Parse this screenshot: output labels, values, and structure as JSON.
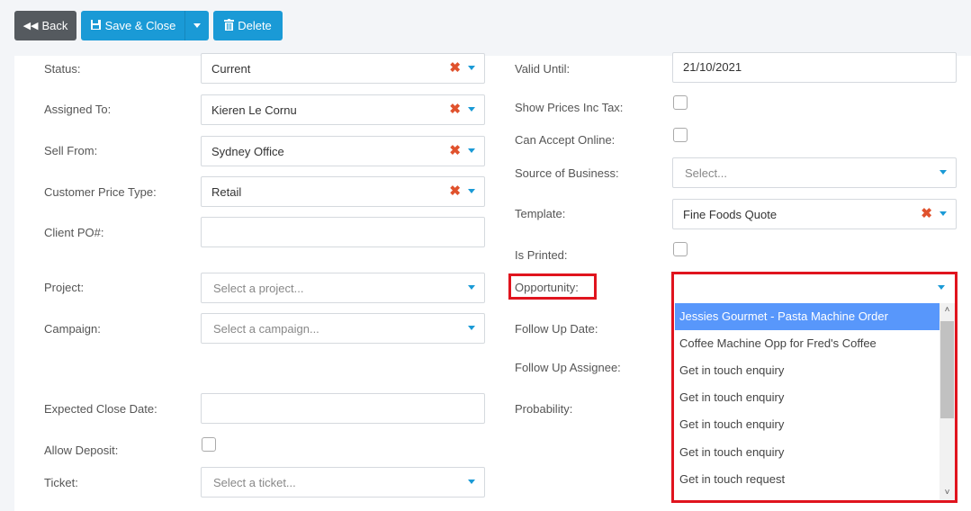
{
  "toolbar": {
    "back_label": "Back",
    "save_close_label": "Save & Close",
    "delete_label": "Delete"
  },
  "left": {
    "status": {
      "label": "Status:",
      "value": "Current"
    },
    "assigned_to": {
      "label": "Assigned To:",
      "value": "Kieren Le Cornu"
    },
    "sell_from": {
      "label": "Sell From:",
      "value": "Sydney Office"
    },
    "customer_price_type": {
      "label": "Customer Price Type:",
      "value": "Retail"
    },
    "client_po": {
      "label": "Client PO#:",
      "value": ""
    },
    "project": {
      "label": "Project:",
      "placeholder": "Select a project..."
    },
    "campaign": {
      "label": "Campaign:",
      "placeholder": "Select a campaign..."
    },
    "expected_close_date": {
      "label": "Expected Close Date:",
      "value": ""
    },
    "allow_deposit": {
      "label": "Allow Deposit:",
      "checked": false
    },
    "ticket": {
      "label": "Ticket:",
      "placeholder": "Select a ticket..."
    }
  },
  "right": {
    "valid_until": {
      "label": "Valid Until:",
      "value": "21/10/2021"
    },
    "show_prices_inc_tax": {
      "label": "Show Prices Inc Tax:",
      "checked": false
    },
    "can_accept_online": {
      "label": "Can Accept Online:",
      "checked": false
    },
    "source_of_business": {
      "label": "Source of Business:",
      "placeholder": "Select..."
    },
    "template": {
      "label": "Template:",
      "value": "Fine Foods Quote"
    },
    "is_printed": {
      "label": "Is Printed:",
      "checked": false
    },
    "opportunity": {
      "label": "Opportunity:",
      "value": ""
    },
    "follow_up_date": {
      "label": "Follow Up Date:"
    },
    "follow_up_assignee": {
      "label": "Follow Up Assignee:"
    },
    "probability": {
      "label": "Probability:"
    }
  },
  "opportunity_dropdown": {
    "options": [
      {
        "label": "Jessies Gourmet - Pasta Machine Order",
        "selected": true
      },
      {
        "label": "Coffee Machine Opp for Fred's Coffee",
        "selected": false
      },
      {
        "label": "Get in touch enquiry",
        "selected": false
      },
      {
        "label": "Get in touch enquiry",
        "selected": false
      },
      {
        "label": "Get in touch enquiry",
        "selected": false
      },
      {
        "label": "Get in touch enquiry",
        "selected": false
      },
      {
        "label": "Get in touch request",
        "selected": false
      }
    ]
  },
  "colors": {
    "primary": "#1a9ad6",
    "back_button": "#555a5f",
    "clear_x": "#e0522d",
    "highlight": "#e0141e",
    "selected_option": "#5897fb"
  }
}
